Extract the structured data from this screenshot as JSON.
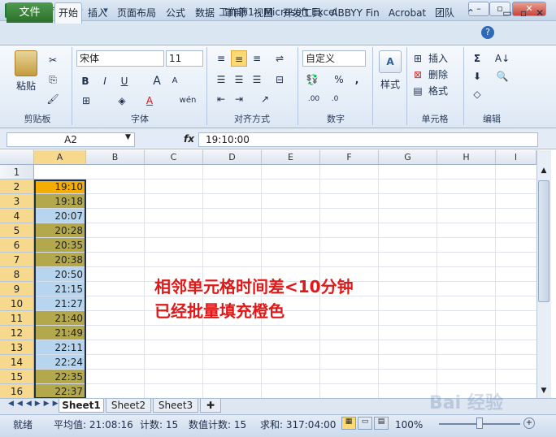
{
  "window": {
    "title": "工作簿1  -  Microsoft Excel",
    "minimize": "–",
    "maximize": "▫",
    "close": "✕"
  },
  "tabs": [
    "文件",
    "开始",
    "插入",
    "页面布局",
    "公式",
    "数据",
    "审阅",
    "视图",
    "开发工具",
    "ABBYY Fin",
    "Acrobat",
    "团队"
  ],
  "ribbon": {
    "clipboard": {
      "paste": "粘贴",
      "group": "剪贴板"
    },
    "font": {
      "name": "宋体",
      "size": "11",
      "bold": "B",
      "italic": "I",
      "underline": "U",
      "grow": "A",
      "shrink": "A",
      "fontcolor": "A",
      "wen": "wén",
      "group": "字体"
    },
    "alignment": {
      "group": "对齐方式"
    },
    "number": {
      "format": "自定义",
      "percent": "%",
      "comma": ",",
      "group": "数字"
    },
    "styles": {
      "label": "样式"
    },
    "cells": {
      "insert": "插入",
      "delete": "删除",
      "format": "格式",
      "group": "单元格"
    },
    "editing": {
      "sum": "Σ",
      "group": "编辑"
    }
  },
  "formula_bar": {
    "name_box": "A2",
    "fx": "fx",
    "value": "19:10:00"
  },
  "columns": [
    "A",
    "B",
    "C",
    "D",
    "E",
    "F",
    "G",
    "H",
    "I"
  ],
  "rows": [
    {
      "num": "1",
      "value": "",
      "color": "none"
    },
    {
      "num": "2",
      "value": "19:10",
      "color": "#f5ad00"
    },
    {
      "num": "3",
      "value": "19:18",
      "color": "#b4a84c"
    },
    {
      "num": "4",
      "value": "20:07",
      "color": "#b8d5ef"
    },
    {
      "num": "5",
      "value": "20:28",
      "color": "#b4a84c"
    },
    {
      "num": "6",
      "value": "20:35",
      "color": "#b4a84c"
    },
    {
      "num": "7",
      "value": "20:38",
      "color": "#b4a84c"
    },
    {
      "num": "8",
      "value": "20:50",
      "color": "#b8d5ef"
    },
    {
      "num": "9",
      "value": "21:15",
      "color": "#b8d5ef"
    },
    {
      "num": "10",
      "value": "21:27",
      "color": "#b8d5ef"
    },
    {
      "num": "11",
      "value": "21:40",
      "color": "#b4a84c"
    },
    {
      "num": "12",
      "value": "21:49",
      "color": "#b4a84c"
    },
    {
      "num": "13",
      "value": "22:11",
      "color": "#b8d5ef"
    },
    {
      "num": "14",
      "value": "22:24",
      "color": "#b8d5ef"
    },
    {
      "num": "15",
      "value": "22:35",
      "color": "#b4a84c"
    },
    {
      "num": "16",
      "value": "22:37",
      "color": "#b4a84c"
    }
  ],
  "annotation": [
    "相邻单元格时间差<10分钟",
    "已经批量填充橙色"
  ],
  "sheets": [
    "Sheet1",
    "Sheet2",
    "Sheet3"
  ],
  "status": {
    "ready": "就绪",
    "average": "平均值: 21:08:16",
    "count": "计数: 15",
    "numcount": "数值计数: 15",
    "sum": "求和: 317:04:00",
    "zoom": "100%"
  },
  "watermark": "Bai 经验"
}
